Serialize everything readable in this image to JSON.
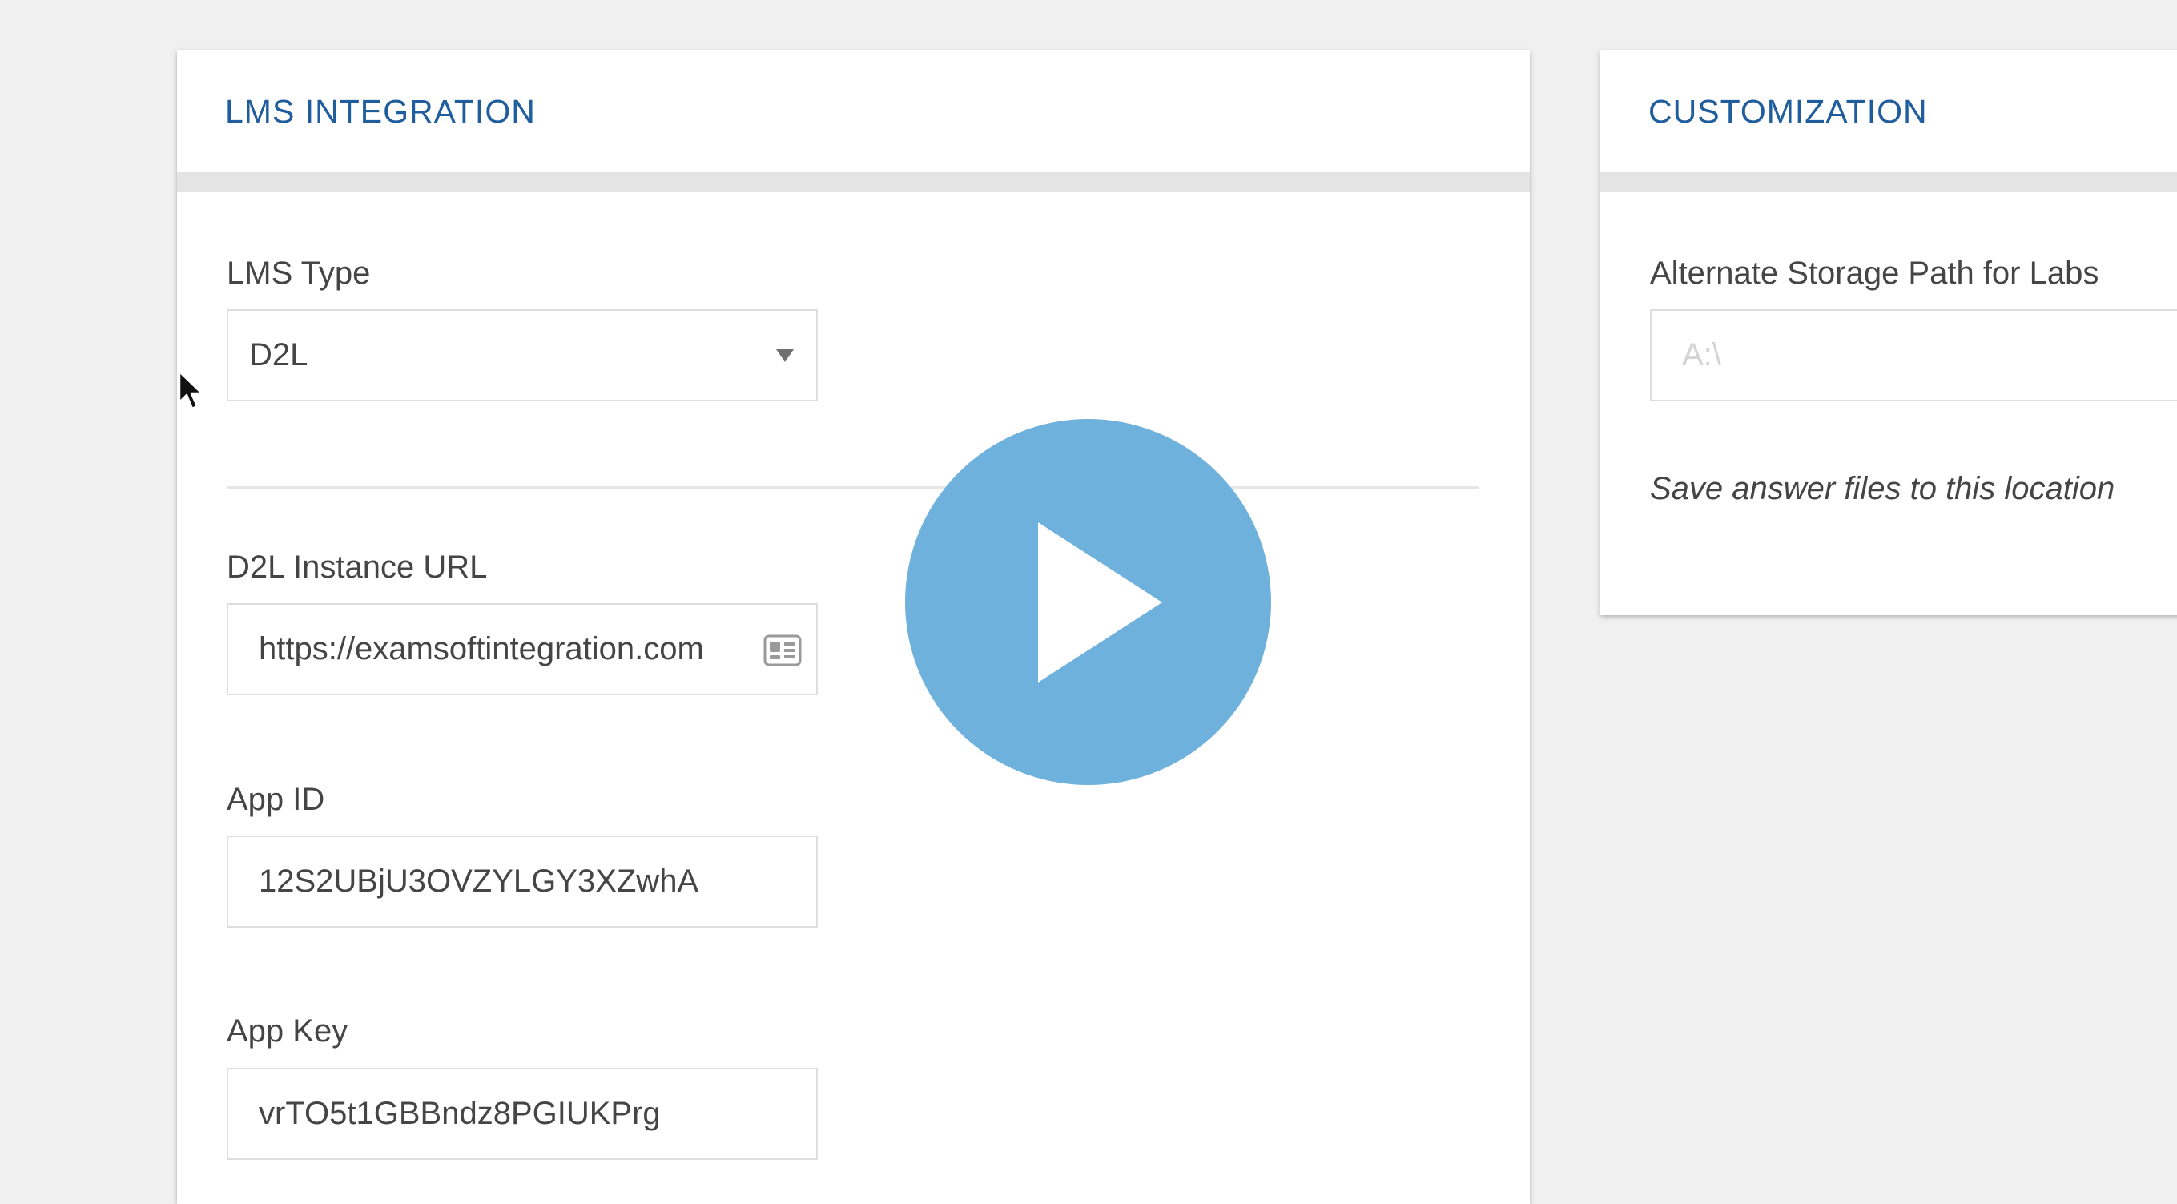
{
  "lms_panel": {
    "title": "LMS INTEGRATION",
    "lms_type": {
      "label": "LMS Type",
      "value": "D2L"
    },
    "instance_url": {
      "label": "D2L Instance URL",
      "value": "https://examsoftintegration.com"
    },
    "app_id": {
      "label": "App ID",
      "value": "12S2UBjU3OVZYLGY3XZwhA"
    },
    "app_key": {
      "label": "App Key",
      "value": "vrTO5t1GBBndz8PGIUKPrg"
    }
  },
  "customization_panel": {
    "title": "CUSTOMIZATION",
    "storage_path": {
      "label": "Alternate Storage Path for Labs",
      "placeholder": "A:\\"
    },
    "help_text": "Save answer files to this location"
  },
  "icons": {
    "url_field_icon": "contact-card-icon",
    "play": "play-icon",
    "cursor": "mouse-pointer-icon"
  },
  "colors": {
    "accent": "#1f5d9c",
    "play_button": "#6fb1dd",
    "background": "#f0f0f0"
  }
}
